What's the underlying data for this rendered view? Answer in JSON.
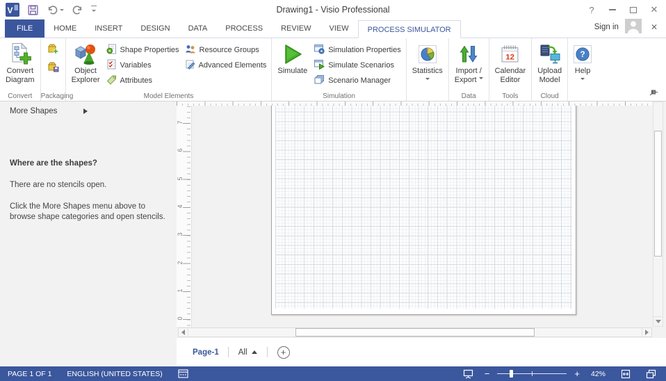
{
  "titlebar": {
    "title": "Drawing1 - Visio Professional",
    "controls": {
      "help": "?",
      "close": "✕"
    }
  },
  "tab_bar": {
    "tabs": [
      {
        "label": "FILE"
      },
      {
        "label": "HOME"
      },
      {
        "label": "INSERT"
      },
      {
        "label": "DESIGN"
      },
      {
        "label": "DATA"
      },
      {
        "label": "PROCESS"
      },
      {
        "label": "REVIEW"
      },
      {
        "label": "VIEW"
      },
      {
        "label": "PROCESS SIMULATOR"
      }
    ],
    "active_tab": "PROCESS SIMULATOR",
    "sign_in": "Sign in",
    "close_glyph": "✕"
  },
  "ribbon": {
    "groups": [
      {
        "label": "Convert",
        "buttons": [
          {
            "icon": "convert-diagram-icon",
            "lines": [
              "Convert",
              "Diagram"
            ]
          }
        ]
      },
      {
        "label": "Packaging",
        "icons": [
          "package-add-icon",
          "package-save-icon"
        ]
      },
      {
        "label": "Model Elements",
        "buttons": [
          {
            "icon": "object-explorer-icon",
            "lines": [
              "Object",
              "Explorer"
            ]
          }
        ],
        "items": [
          {
            "icon": "shape-properties-icon",
            "label": "Shape Properties"
          },
          {
            "icon": "variables-icon",
            "label": "Variables"
          },
          {
            "icon": "attributes-icon",
            "label": "Attributes"
          },
          {
            "icon": "resource-groups-icon",
            "label": "Resource Groups"
          },
          {
            "icon": "advanced-elements-icon",
            "label": "Advanced Elements"
          }
        ]
      },
      {
        "label": "Simulation",
        "buttons": [
          {
            "icon": "simulate-icon",
            "lines": [
              "Simulate"
            ]
          }
        ],
        "items": [
          {
            "icon": "simulation-properties-icon",
            "label": "Simulation Properties"
          },
          {
            "icon": "simulate-scenarios-icon",
            "label": "Simulate Scenarios"
          },
          {
            "icon": "scenario-manager-icon",
            "label": "Scenario Manager"
          }
        ]
      },
      {
        "label": "",
        "buttons": [
          {
            "icon": "statistics-icon",
            "lines": [
              "Statistics"
            ],
            "dropdown": true
          }
        ]
      },
      {
        "label": "Data",
        "buttons": [
          {
            "icon": "import-export-icon",
            "lines": [
              "Import /",
              "Export"
            ],
            "dropdown": true
          }
        ]
      },
      {
        "label": "Tools",
        "buttons": [
          {
            "icon": "calendar-editor-icon",
            "lines": [
              "Calendar",
              "Editor"
            ]
          }
        ]
      },
      {
        "label": "Cloud",
        "buttons": [
          {
            "icon": "upload-model-icon",
            "lines": [
              "Upload",
              "Model"
            ]
          }
        ]
      },
      {
        "label": "",
        "buttons": [
          {
            "icon": "help-icon",
            "lines": [
              "Help"
            ],
            "dropdown": true
          }
        ]
      }
    ]
  },
  "shapes_panel": {
    "more_shapes_label": "More Shapes",
    "help_title": "Where are the shapes?",
    "help_text1": "There are no stencils open.",
    "help_text2": "Click the More Shapes menu above to browse shape categories and open stencils."
  },
  "canvas": {
    "ruler_numbers": [
      "7",
      "6",
      "5",
      "4",
      "3",
      "2",
      "1",
      "0"
    ]
  },
  "page_bar": {
    "page_tab": "Page-1",
    "all_label": "All"
  },
  "status_bar": {
    "page_indicator": "PAGE 1 OF 1",
    "language": "ENGLISH (UNITED STATES)",
    "zoom_out": "−",
    "zoom_in": "+",
    "zoom_level": "42%"
  },
  "icons": {
    "visio_letter": "V",
    "calendar_day": "12",
    "help_glyph": "?",
    "add_page_glyph": "+"
  },
  "colors": {
    "accent": "#3b569d",
    "status_bar": "#3b579d",
    "file_tab": "#3b569d"
  }
}
